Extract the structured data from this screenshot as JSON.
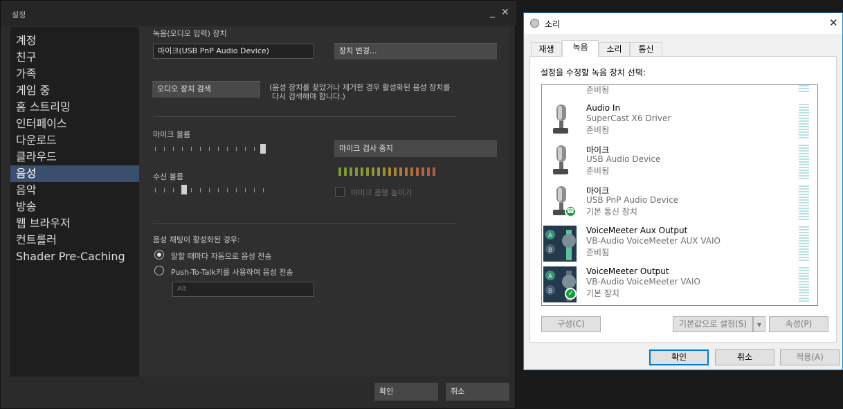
{
  "steam": {
    "title": "설정",
    "minimize": "_",
    "close": "✕",
    "sidebar": [
      "계정",
      "친구",
      "가족",
      "게임 중",
      "홈 스트리밍",
      "인터페이스",
      "다운로드",
      "클라우드",
      "음성",
      "음악",
      "방송",
      "웹 브라우저",
      "컨트롤러",
      "Shader Pre-Caching"
    ],
    "active_index": 8,
    "recording_label": "녹음(오디오 입력) 장치",
    "device_value": "마이크(USB PnP Audio Device)",
    "change_device": "장치 변경...",
    "detect_devices": "오디오 장치 검색",
    "detect_hint_1": "(음성 장치를 꽂았거나 제거한 경우 활성화된 음성 장치를",
    "detect_hint_2": "다시 검색해야 합니다.)",
    "mic_volume": "마이크 볼륨",
    "mic_test_stop": "마이크 검사 중지",
    "receive_volume": "수신 볼륨",
    "mic_boost": "마이크 음향 높이기",
    "voice_chat_label": "음성 채팅이 활성화된 경우:",
    "auto_transmit": "말할 때마다 자동으로 음성 전송",
    "ptt_transmit": "Push-To-Talk키를 사용하여 음성 전송",
    "ptt_key": "Alt",
    "ok": "확인",
    "cancel": "취소"
  },
  "sound": {
    "title": "소리",
    "close": "✕",
    "tabs": [
      "재생",
      "녹음",
      "소리",
      "통신"
    ],
    "active_tab": 1,
    "prompt": "설정을 수정할 녹음 장치 선택:",
    "devices": [
      {
        "name": "",
        "driver": "",
        "status": "준비됨"
      },
      {
        "name": "Audio In",
        "driver": "SuperCast X6 Driver",
        "status": "준비됨"
      },
      {
        "name": "마이크",
        "driver": "USB Audio Device",
        "status": "준비됨"
      },
      {
        "name": "마이크",
        "driver": "USB PnP Audio Device",
        "status": "기본 통신 장치"
      },
      {
        "name": "VoiceMeeter Aux Output",
        "driver": "VB-Audio VoiceMeeter AUX VAIO",
        "status": "준비됨"
      },
      {
        "name": "VoiceMeeter Output",
        "driver": "VB-Audio VoiceMeeter VAIO",
        "status": "기본 장치"
      }
    ],
    "vm_a": "A",
    "vm_b": "B",
    "configure": "구성(C)",
    "set_default": "기본값으로 설정(S)",
    "properties": "속성(P)",
    "ok": "확인",
    "cancel": "취소",
    "apply": "적용(A)"
  }
}
